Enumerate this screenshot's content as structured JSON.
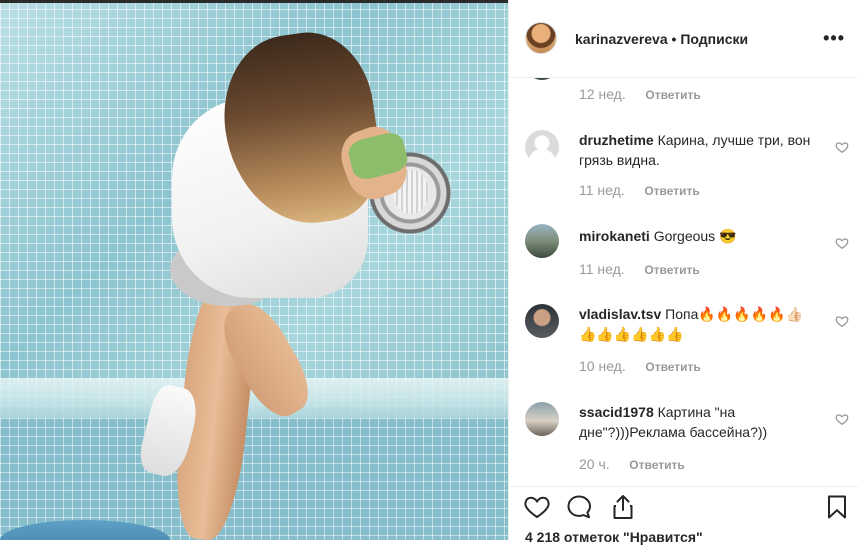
{
  "post": {
    "username": "karinazvereva",
    "separator": "•",
    "follow_label": "Подписки",
    "more_label": "•••"
  },
  "comments": [
    {
      "user": "",
      "text": "",
      "time": "12 нед.",
      "reply": "Ответить"
    },
    {
      "user": "druzhetime",
      "text": " Карина, лучше три, вон грязь видна.",
      "time": "11 нед.",
      "reply": "Ответить"
    },
    {
      "user": "mirokaneti",
      "text": " Gorgeous 😎",
      "time": "11 нед.",
      "reply": "Ответить"
    },
    {
      "user": "vladislav.tsv",
      "text": " Попа🔥🔥🔥🔥🔥👍🏻👍👍👍👍👍👍",
      "time": "10 нед.",
      "reply": "Ответить"
    },
    {
      "user": "ssacid1978",
      "text": " Картина \"на дне\"?)))Реклама бассейна?))",
      "time": "20 ч.",
      "reply": "Ответить"
    }
  ],
  "footer": {
    "likes": "4 218 отметок \"Нравится\""
  },
  "icons": {
    "like": "heart-icon",
    "comment": "comment-icon",
    "share": "share-icon",
    "save": "bookmark-icon",
    "more": "more-options-icon"
  }
}
